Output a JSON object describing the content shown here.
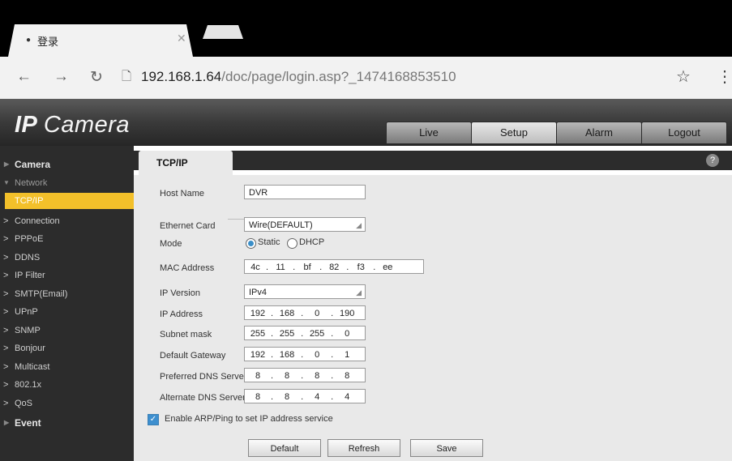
{
  "browser": {
    "tab_title": "登录",
    "url_host": "192.168.1.64",
    "url_path": "/doc/page/login.asp?_1474168853510"
  },
  "app": {
    "logo_main": "IP",
    "logo_sub": "Camera",
    "top_nav": [
      "Live",
      "Setup",
      "Alarm",
      "Logout"
    ],
    "active_top_nav": "Setup"
  },
  "sidebar": {
    "camera": "Camera",
    "network": "Network",
    "items": [
      "TCP/IP",
      "Connection",
      "PPPoE",
      "DDNS",
      "IP Filter",
      "SMTP(Email)",
      "UPnP",
      "SNMP",
      "Bonjour",
      "Multicast",
      "802.1x",
      "QoS"
    ],
    "active_item": "TCP/IP",
    "event": "Event"
  },
  "panel": {
    "title": "TCP/IP",
    "help_icon": "?"
  },
  "form": {
    "host_name_label": "Host Name",
    "host_name_value": "DVR",
    "ethernet_card_label": "Ethernet Card",
    "ethernet_card_value": "Wire(DEFAULT)",
    "mode_label": "Mode",
    "mode_static": "Static",
    "mode_dhcp": "DHCP",
    "mode_selected": "Static",
    "mac_label": "MAC Address",
    "mac": [
      "4c",
      "11",
      "bf",
      "82",
      "f3",
      "ee"
    ],
    "ip_version_label": "IP Version",
    "ip_version_value": "IPv4",
    "ip_address_label": "IP Address",
    "ip_address": [
      "192",
      "168",
      "0",
      "190"
    ],
    "subnet_label": "Subnet mask",
    "subnet": [
      "255",
      "255",
      "255",
      "0"
    ],
    "gateway_label": "Default Gateway",
    "gateway": [
      "192",
      "168",
      "0",
      "1"
    ],
    "pref_dns_label": "Preferred DNS Server",
    "pref_dns": [
      "8",
      "8",
      "8",
      "8"
    ],
    "alt_dns_label": "Alternate DNS Server",
    "alt_dns": [
      "8",
      "8",
      "4",
      "4"
    ],
    "arp_label": "Enable ARP/Ping to set IP address service",
    "arp_checked": true
  },
  "buttons": {
    "default": "Default",
    "refresh": "Refresh",
    "save": "Save"
  },
  "colors": {
    "accent_active": "#f3c02a",
    "sidebar_bg": "#2c2c2c",
    "content_bg": "#e9e9e9"
  }
}
